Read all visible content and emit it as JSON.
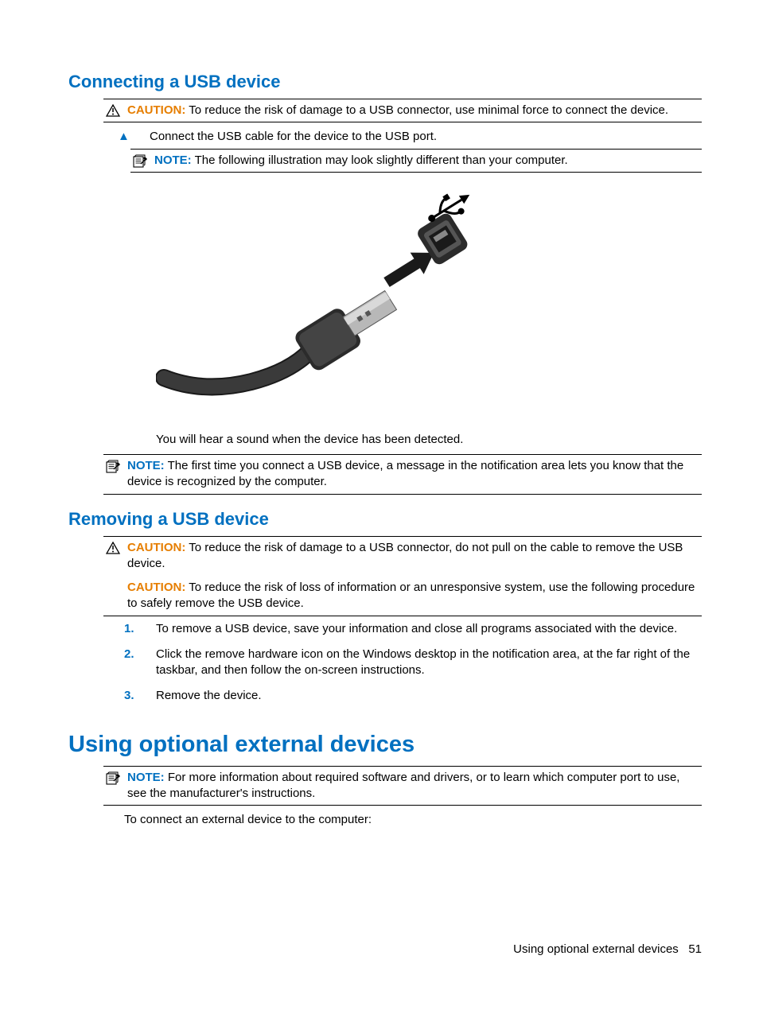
{
  "section1": {
    "heading": "Connecting a USB device",
    "caution_label": "CAUTION:",
    "caution_text": " To reduce the risk of damage to a USB connector, use minimal force to connect the device.",
    "step_marker": "▲",
    "step_text": "Connect the USB cable for the device to the USB port.",
    "inner_note_label": "NOTE:",
    "inner_note_text": " The following illustration may look slightly different than your computer.",
    "after_illustration": "You will hear a sound when the device has been detected.",
    "outer_note_label": "NOTE:",
    "outer_note_text": " The first time you connect a USB device, a message in the notification area lets you know that the device is recognized by the computer."
  },
  "section2": {
    "heading": "Removing a USB device",
    "caution1_label": "CAUTION:",
    "caution1_text": " To reduce the risk of damage to a USB connector, do not pull on the cable to remove the USB device.",
    "caution2_label": "CAUTION:",
    "caution2_text": " To reduce the risk of loss of information or an unresponsive system, use the following procedure to safely remove the USB device.",
    "steps": [
      {
        "num": "1.",
        "text": "To remove a USB device, save your information and close all programs associated with the device."
      },
      {
        "num": "2.",
        "text": "Click the remove hardware icon on the Windows desktop in the notification area, at the far right of the taskbar, and then follow the on-screen instructions."
      },
      {
        "num": "3.",
        "text": "Remove the device."
      }
    ]
  },
  "section3": {
    "heading": "Using optional external devices",
    "note_label": "NOTE:",
    "note_text": " For more information about required software and drivers, or to learn which computer port to use, see the manufacturer's instructions.",
    "line": "To connect an external device to the computer:"
  },
  "footer": {
    "text": "Using optional external devices",
    "page": "51"
  }
}
